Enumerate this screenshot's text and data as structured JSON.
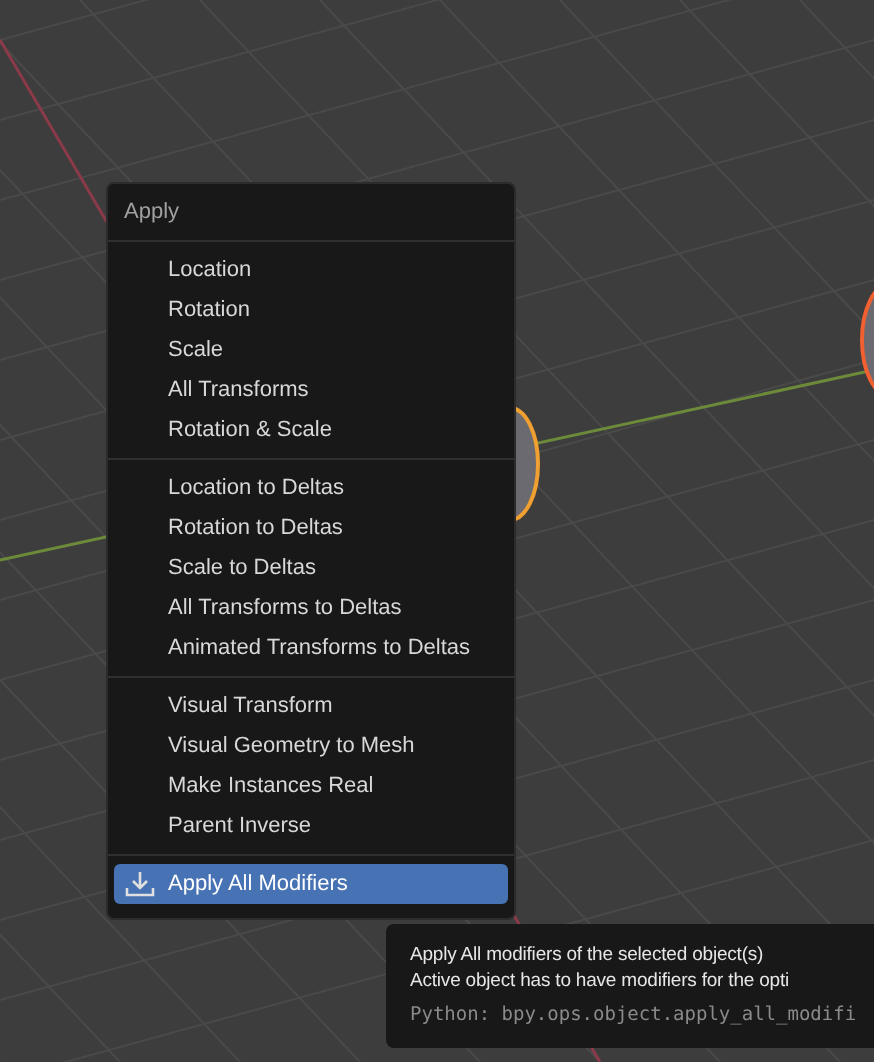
{
  "menu": {
    "title": "Apply",
    "groups": [
      [
        {
          "label": "Location",
          "selected": false
        },
        {
          "label": "Rotation",
          "selected": false
        },
        {
          "label": "Scale",
          "selected": false
        },
        {
          "label": "All Transforms",
          "selected": false
        },
        {
          "label": "Rotation & Scale",
          "selected": false
        }
      ],
      [
        {
          "label": "Location to Deltas",
          "selected": false
        },
        {
          "label": "Rotation to Deltas",
          "selected": false
        },
        {
          "label": "Scale to Deltas",
          "selected": false
        },
        {
          "label": "All Transforms to Deltas",
          "selected": false
        },
        {
          "label": "Animated Transforms to Deltas",
          "selected": false
        }
      ],
      [
        {
          "label": "Visual Transform",
          "selected": false
        },
        {
          "label": "Visual Geometry to Mesh",
          "selected": false
        },
        {
          "label": "Make Instances Real",
          "selected": false
        },
        {
          "label": "Parent Inverse",
          "selected": false
        }
      ],
      [
        {
          "label": "Apply All Modifiers",
          "selected": true,
          "kind": "action"
        }
      ]
    ]
  },
  "tooltip": {
    "lines": [
      "Apply All modifiers of the selected object(s)",
      "Active object has to have modifiers for the opti"
    ],
    "python": "Python: bpy.ops.object.apply_all_modifi"
  }
}
